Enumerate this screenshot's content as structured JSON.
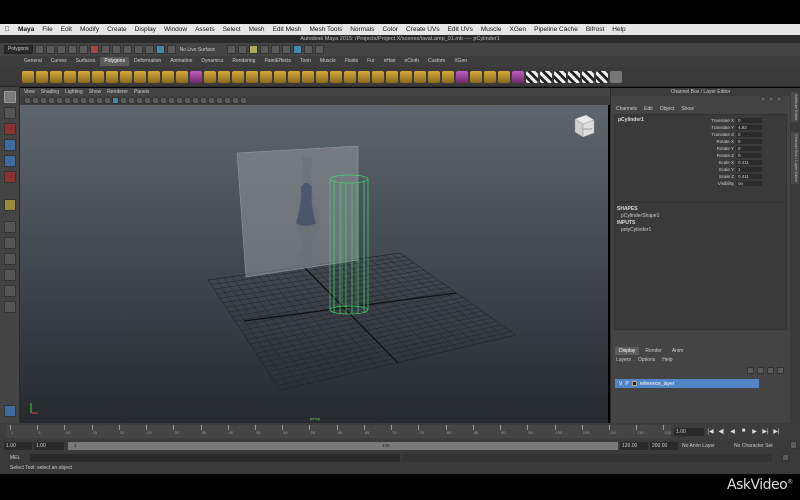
{
  "mac_menubar": {
    "apple": "",
    "items": [
      "Maya",
      "File",
      "Edit",
      "Modify",
      "Create",
      "Display",
      "Window",
      "Assets",
      "Select",
      "Mesh",
      "Edit Mesh",
      "Mesh Tools",
      "Normals",
      "Color",
      "Create UVs",
      "Edit UVs",
      "Muscle",
      "XGen",
      "Pipeline Cache",
      "Bifrost",
      "Help"
    ]
  },
  "title": "Autodesk Maya 2015: /Projects/Project X/scenes/lavaLamp_01.mb   ----   pCylinder1",
  "status_line": {
    "menu_set": "Polygons",
    "live_surface": "No Live Surface"
  },
  "shelf_tabs": [
    "General",
    "Curves",
    "Surfaces",
    "Polygons",
    "Deformation",
    "Animation",
    "Dynamics",
    "Rendering",
    "PaintEffects",
    "Toon",
    "Muscle",
    "Fluids",
    "Fur",
    "nHair",
    "nCloth",
    "Custom",
    "XGen"
  ],
  "active_shelf": "Polygons",
  "viewport_menu": [
    "View",
    "Shading",
    "Lighting",
    "Show",
    "Renderer",
    "Panels"
  ],
  "viewport": {
    "view_cube_label": "RIGHT",
    "camera_label": "persp"
  },
  "channel_box": {
    "panel_title": "Channel Box / Layer Editor",
    "menu": [
      "Channels",
      "Edit",
      "Object",
      "Show"
    ],
    "object_name": "pCylinder1",
    "attributes": [
      {
        "name": "Translate X",
        "value": "0"
      },
      {
        "name": "Translate Y",
        "value": "4.92"
      },
      {
        "name": "Translate Z",
        "value": "0"
      },
      {
        "name": "Rotate X",
        "value": "0"
      },
      {
        "name": "Rotate Y",
        "value": "0"
      },
      {
        "name": "Rotate Z",
        "value": "0"
      },
      {
        "name": "Scale X",
        "value": "0.411"
      },
      {
        "name": "Scale Y",
        "value": "1"
      },
      {
        "name": "Scale Z",
        "value": "0.411"
      },
      {
        "name": "Visibility",
        "value": "on"
      }
    ],
    "shapes_header": "SHAPES",
    "shape_name": "pCylinderShape1",
    "inputs_header": "INPUTS",
    "input_name": "polyCylinder1"
  },
  "side_tabs": [
    "Attribute Editor",
    "Channel Box / Layer Editor"
  ],
  "layer_editor": {
    "tabs": [
      "Display",
      "Render",
      "Anim"
    ],
    "active_tab": "Display",
    "menu": [
      "Layers",
      "Options",
      "Help"
    ],
    "layers": [
      {
        "v": "V",
        "p": "P",
        "name": "reference_layer"
      }
    ]
  },
  "timeline": {
    "ticks": [
      "1",
      "5",
      "10",
      "15",
      "20",
      "25",
      "30",
      "35",
      "40",
      "45",
      "50",
      "55",
      "60",
      "65",
      "70",
      "75",
      "80",
      "85",
      "90",
      "95",
      "100",
      "105",
      "110",
      "115",
      "120"
    ],
    "current_frame": "1.00",
    "playback_buttons": [
      "|◀",
      "◀|",
      "◀",
      "■",
      "▶",
      "▶|",
      "▶|"
    ]
  },
  "range": {
    "start": "1.00",
    "anim_start": "1.00",
    "slider_start": "1",
    "slider_end": "120",
    "end": "120.00",
    "anim_end": "200.00",
    "anim_layer": "No Anim Layer",
    "char_set": "No Character Set"
  },
  "command_line": {
    "label": "MEL"
  },
  "help_line": "Select Tool: select an object",
  "watermark": {
    "text": "AskVideo",
    "mark": "®"
  },
  "colors": {
    "layer_highlight": "#5285c5",
    "wireframe_select": "#3fd76f",
    "menubar_bg": "#e6e6e6"
  }
}
